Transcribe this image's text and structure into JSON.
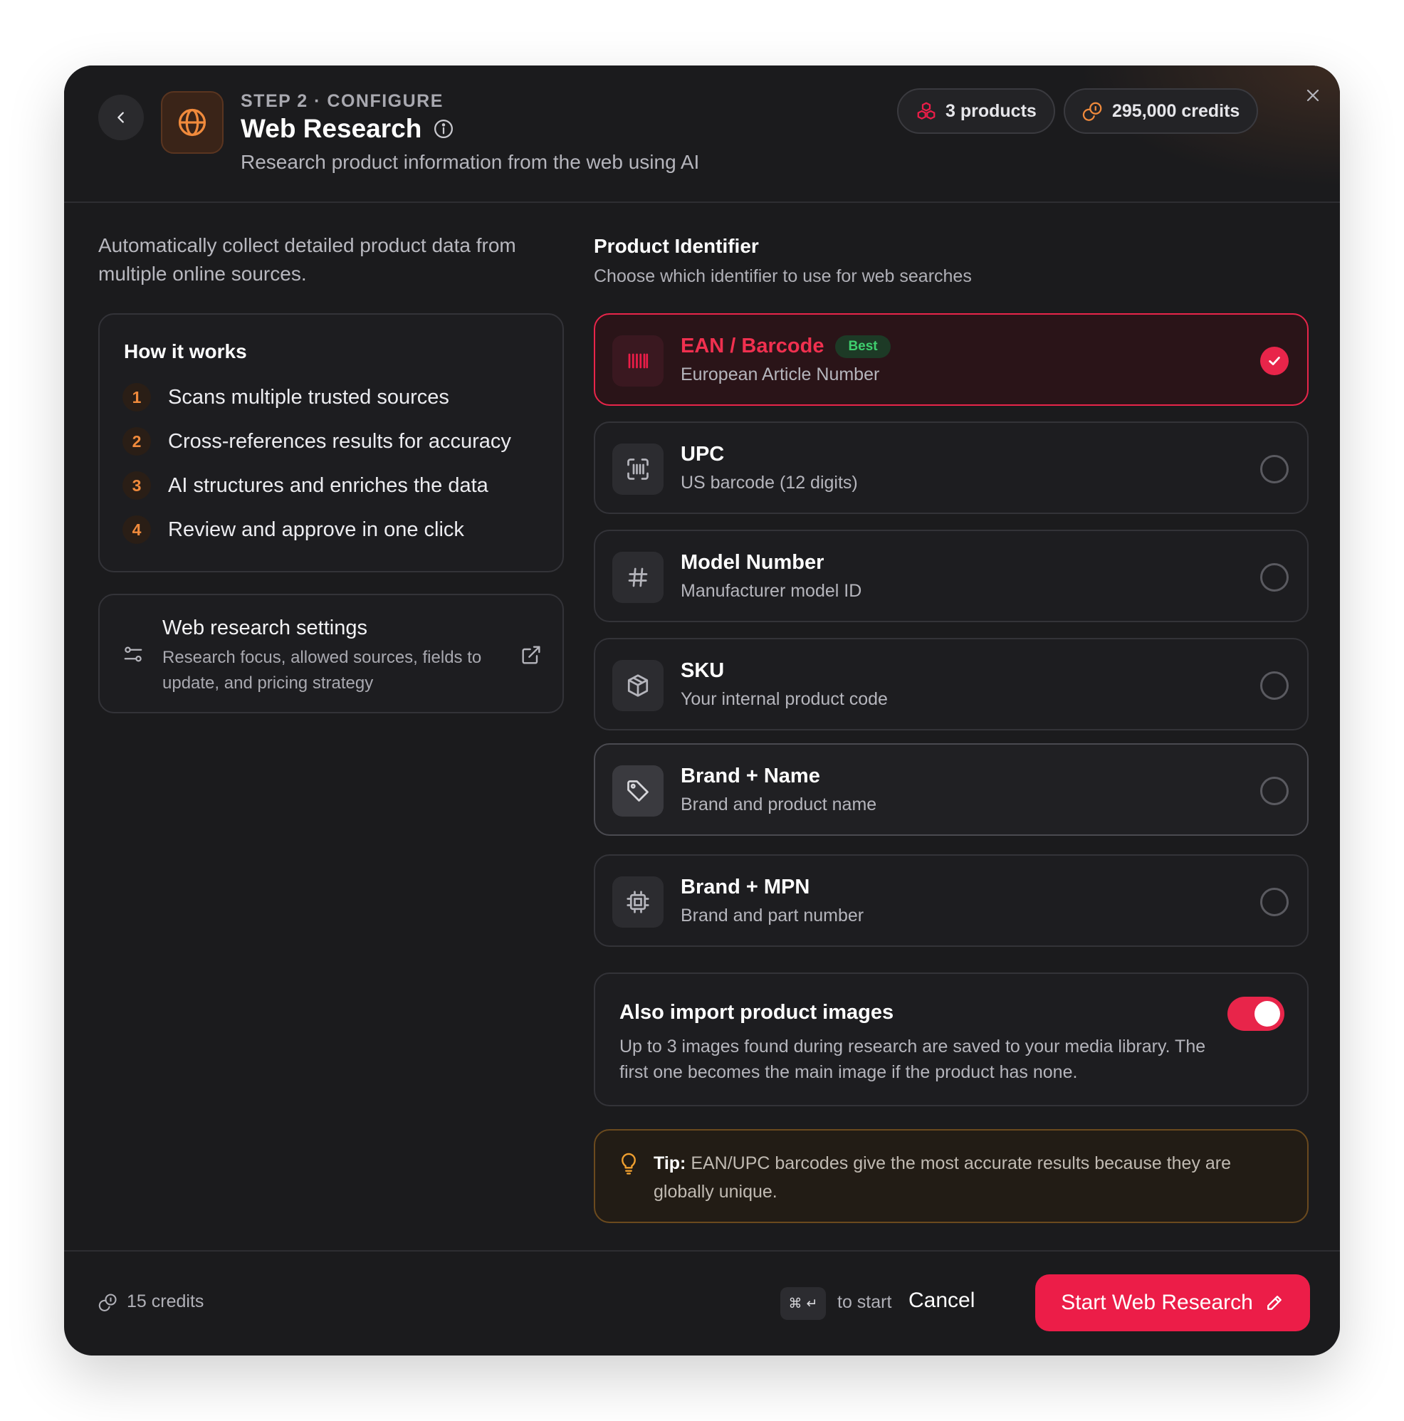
{
  "header": {
    "step_label": "STEP 2 · CONFIGURE",
    "title": "Web Research",
    "subtitle": "Research product information from the web using AI",
    "products_pill": "3 products",
    "credits_pill": "295,000 credits"
  },
  "left": {
    "intro": "Automatically collect detailed product data from multiple online sources.",
    "how_title": "How it works",
    "steps": [
      {
        "num": "1",
        "text": "Scans multiple trusted sources"
      },
      {
        "num": "2",
        "text": "Cross-references results for accuracy"
      },
      {
        "num": "3",
        "text": "AI structures and enriches the data"
      },
      {
        "num": "4",
        "text": "Review and approve in one click"
      }
    ],
    "settings_title": "Web research settings",
    "settings_desc": "Research focus, allowed sources, fields to update, and pricing strategy"
  },
  "identifier": {
    "title": "Product Identifier",
    "subtitle": "Choose which identifier to use for web searches",
    "options": [
      {
        "title": "EAN / Barcode",
        "badge": "Best",
        "sub": "European Article Number",
        "icon": "barcode-icon",
        "selected": true
      },
      {
        "title": "UPC",
        "sub": "US barcode (12 digits)",
        "icon": "scan-barcode-icon",
        "selected": false
      },
      {
        "title": "Model Number",
        "sub": "Manufacturer model ID",
        "icon": "hash-icon",
        "selected": false
      },
      {
        "title": "SKU",
        "sub": "Your internal product code",
        "icon": "box-icon",
        "selected": false
      },
      {
        "title": "Brand + Name",
        "sub": "Brand and product name",
        "icon": "tag-icon",
        "selected": false
      },
      {
        "title": "Brand + MPN",
        "sub": "Brand and part number",
        "icon": "chip-icon",
        "selected": false
      }
    ]
  },
  "images": {
    "title": "Also import product images",
    "desc": "Up to 3 images found during research are saved to your media library. The first one becomes the main image if the product has none.",
    "enabled": true
  },
  "tip": {
    "label": "Tip:",
    "text": " EAN/UPC barcodes give the most accurate results because they are globally unique."
  },
  "footer": {
    "credits": "15 credits",
    "shortcut": "⌘ ↵",
    "to_start": "to start",
    "cancel": "Cancel",
    "start": "Start Web Research"
  },
  "colors": {
    "accent": "#ec1d48",
    "orange": "#f08a3c",
    "success": "#3fcf6e",
    "background": "#1b1b1d"
  }
}
